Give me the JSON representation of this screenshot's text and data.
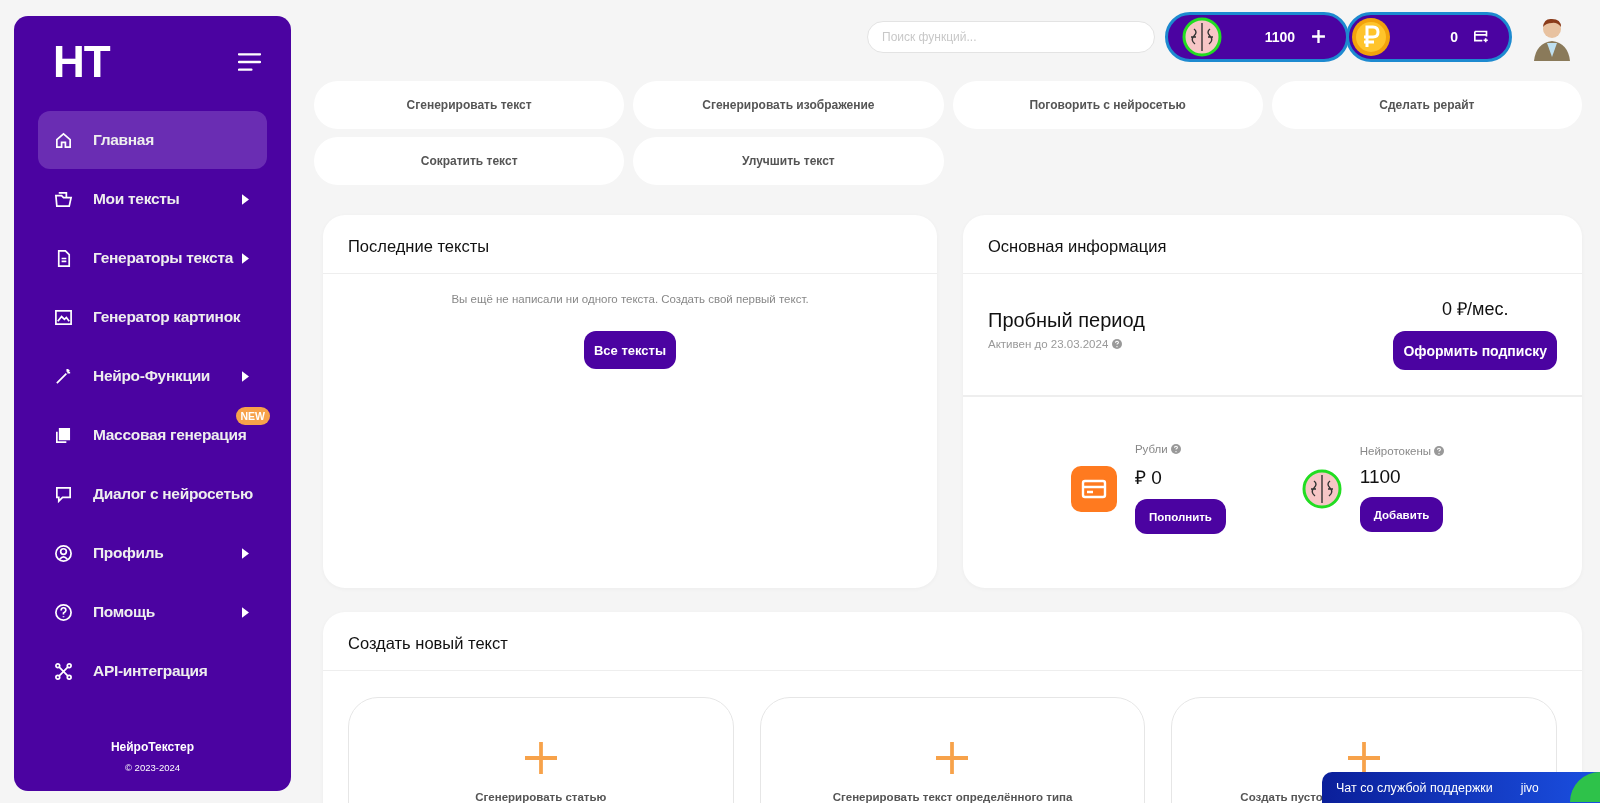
{
  "sidebar": {
    "logo": "НТ",
    "items": [
      {
        "label": "Главная",
        "selected": true,
        "has_submenu": false
      },
      {
        "label": "Мои тексты",
        "selected": false,
        "has_submenu": true
      },
      {
        "label": "Генераторы текста",
        "selected": false,
        "has_submenu": true
      },
      {
        "label": "Генератор картинок",
        "selected": false,
        "has_submenu": false
      },
      {
        "label": "Нейро-Функции",
        "selected": false,
        "has_submenu": true
      },
      {
        "label": "Массовая генерация",
        "selected": false,
        "has_submenu": false,
        "badge": "NEW"
      },
      {
        "label": "Диалог с нейросетью",
        "selected": false,
        "has_submenu": false
      },
      {
        "label": "Профиль",
        "selected": false,
        "has_submenu": true
      },
      {
        "label": "Помощь",
        "selected": false,
        "has_submenu": true
      },
      {
        "label": "API-интеграция",
        "selected": false,
        "has_submenu": false
      }
    ],
    "footer": {
      "brand": "НейроТекстер",
      "copyright": "© 2023-2024"
    }
  },
  "topbar": {
    "search": {
      "placeholder": "Поиск функций..."
    },
    "tokens": "1100",
    "rubles": "0"
  },
  "quick_actions": [
    "Сгенерировать текст",
    "Сгенерировать изображение",
    "Поговорить с нейросетью",
    "Сделать рерайт",
    "Сократить текст",
    "Улучшить текст"
  ],
  "recent_texts": {
    "title": "Последние тексты",
    "empty_message": "Вы ещё не написали ни одного текста. Создать свой первый текст.",
    "button": "Все тексты"
  },
  "info": {
    "title": "Основная информация",
    "plan": "Пробный период",
    "active_until": "Активен до 23.03.2024",
    "price": "0 ₽/мес.",
    "subscribe_button": "Оформить подписку",
    "balances": [
      {
        "kind": "rubles",
        "label": "Рубли",
        "value": "₽ 0",
        "button": "Пополнить"
      },
      {
        "kind": "tokens",
        "label": "Нейротокены",
        "value": "1100",
        "button": "Добавить"
      }
    ]
  },
  "create": {
    "title": "Создать новый текст",
    "options": [
      "Сгенерировать статью",
      "Сгенерировать текст определённого типа",
      "Создать пусто"
    ]
  },
  "chat": {
    "label": "Чат со службой поддержки",
    "brand": "jivo"
  }
}
